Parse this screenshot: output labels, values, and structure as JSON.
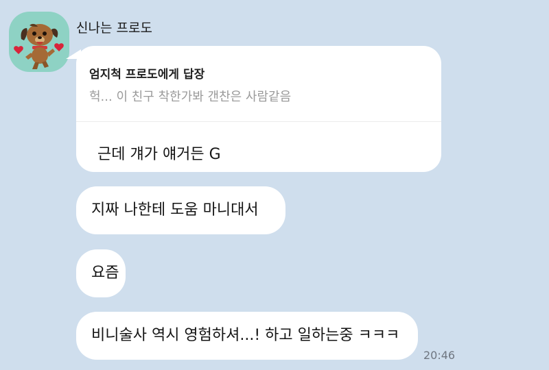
{
  "chat": {
    "sender_name": "신나는 프로도",
    "avatar_icon": "frodo-dog-avatar-icon",
    "reply": {
      "header": "엄지척 프로도에게 답장",
      "quoted_text": "헉... 이 친구 착한가봐 갠찬은 사람같음",
      "text": "근데 걔가 얘거든 G"
    },
    "messages": [
      {
        "text": "지짜 나한테 도움 마니대서"
      },
      {
        "text": "요즘"
      },
      {
        "text": "비니술사 역시 영험하셔...! 하고 일하는중 ㅋㅋㅋ"
      }
    ],
    "timestamp": "20:46"
  },
  "colors": {
    "background": "#cfdeed",
    "bubble": "#ffffff",
    "avatar_background": "#8ed2c4"
  }
}
